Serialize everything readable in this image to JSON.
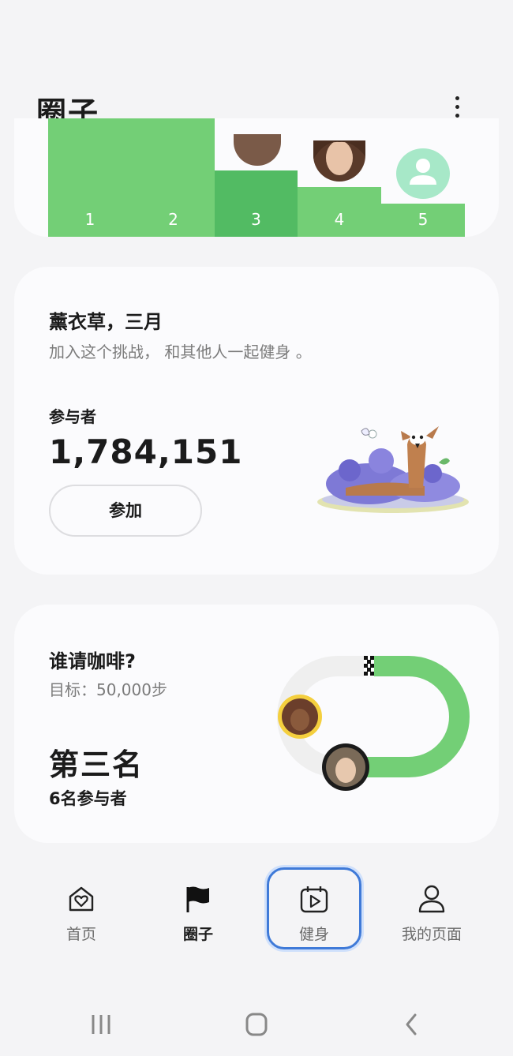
{
  "header": {
    "title": "圈子",
    "more_icon": "more-vertical-icon"
  },
  "leaderboard": {
    "ranks": [
      "1",
      "2",
      "3",
      "4",
      "5"
    ],
    "current_rank": "3",
    "colors": {
      "bar": "#73cf76",
      "bar_current": "#52bb63"
    }
  },
  "challenge": {
    "title": "薰衣草，三月",
    "subtitle": "加入这个挑战， 和其他人一起健身 。",
    "participants_label": "参与者",
    "participants_count": "1,784,151",
    "join_label": "参加"
  },
  "coffee": {
    "title": "谁请咖啡?",
    "goal": "目标：50,000步",
    "rank": "第三名",
    "participants": "6名参与者",
    "progress_color": "#73cf76"
  },
  "nav": {
    "items": [
      {
        "label": "首页",
        "icon": "home-heart-icon"
      },
      {
        "label": "圈子",
        "icon": "flag-icon",
        "active": true
      },
      {
        "label": "健身",
        "icon": "calendar-play-icon",
        "focused": true
      },
      {
        "label": "我的页面",
        "icon": "person-icon"
      }
    ]
  },
  "system": {
    "buttons": [
      "recent-apps-icon",
      "home-icon",
      "back-icon"
    ]
  }
}
